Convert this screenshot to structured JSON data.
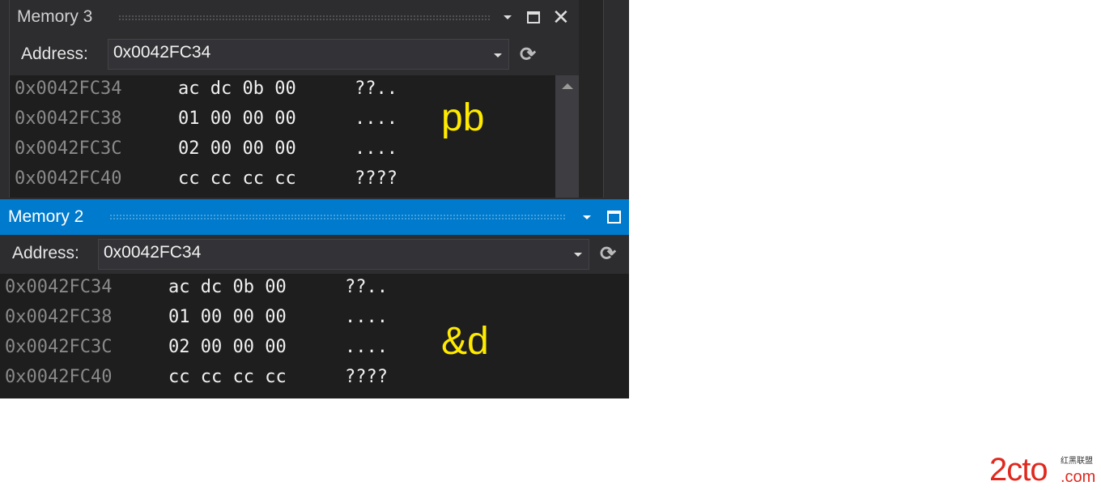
{
  "memory3": {
    "title": "Memory 3",
    "address_label": "Address:",
    "address_value": "0x0042FC34",
    "rows": [
      {
        "addr": "0x0042FC34",
        "bytes": "ac dc 0b 00",
        "ascii": "??.."
      },
      {
        "addr": "0x0042FC38",
        "bytes": "01 00 00 00",
        "ascii": "...."
      },
      {
        "addr": "0x0042FC3C",
        "bytes": "02 00 00 00",
        "ascii": "...."
      },
      {
        "addr": "0x0042FC40",
        "bytes": "cc cc cc cc",
        "ascii": "????"
      }
    ],
    "annotation": "pb"
  },
  "memory2": {
    "title": "Memory 2",
    "address_label": "Address:",
    "address_value": "0x0042FC34",
    "rows": [
      {
        "addr": "0x0042FC34",
        "bytes": "ac dc 0b 00",
        "ascii": "??.."
      },
      {
        "addr": "0x0042FC38",
        "bytes": "01 00 00 00",
        "ascii": "...."
      },
      {
        "addr": "0x0042FC3C",
        "bytes": "02 00 00 00",
        "ascii": "...."
      },
      {
        "addr": "0x0042FC40",
        "bytes": "cc cc cc cc",
        "ascii": "????"
      }
    ],
    "annotation": "&d"
  },
  "watermark": {
    "logo": "2cto.com",
    "tagline": "红黑联盟"
  },
  "colors": {
    "active_title": "#007acc",
    "annotation": "#ffea00",
    "watermark": "#e0291e"
  }
}
